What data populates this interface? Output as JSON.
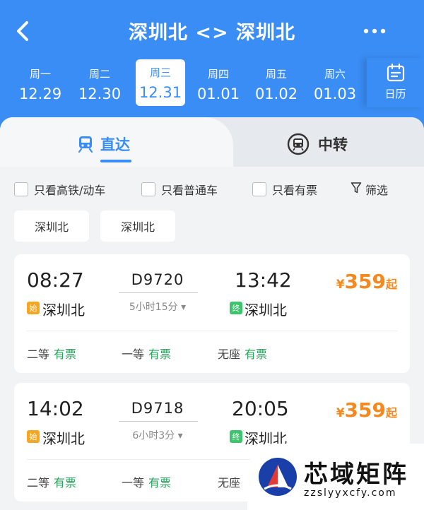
{
  "header": {
    "title": "深圳北 <> 深圳北",
    "dates": [
      {
        "weekday": "周一",
        "date": "12.29"
      },
      {
        "weekday": "周二",
        "date": "12.30"
      },
      {
        "weekday": "周三",
        "date": "12.31"
      },
      {
        "weekday": "周四",
        "date": "01.01"
      },
      {
        "weekday": "周五",
        "date": "01.02"
      },
      {
        "weekday": "周六",
        "date": "01.03"
      }
    ],
    "selected_date_index": 2,
    "calendar_label": "日历"
  },
  "tabs": {
    "direct": "直达",
    "transfer": "中转"
  },
  "filters": {
    "high_speed": "只看高铁/动车",
    "regular": "只看普通车",
    "available": "只看有票",
    "filter": "筛选"
  },
  "stations": [
    "深圳北",
    "深圳北"
  ],
  "trains": [
    {
      "depart_time": "08:27",
      "train_no": "D9720",
      "duration": "5小时15分",
      "arrive_time": "13:42",
      "from_badge": "始",
      "from": "深圳北",
      "to_badge": "终",
      "to": "深圳北",
      "price_symbol": "¥",
      "price": "359",
      "price_suffix": "起",
      "seats": [
        {
          "class": "二等",
          "status": "有票"
        },
        {
          "class": "一等",
          "status": "有票"
        },
        {
          "class": "无座",
          "status": "有票"
        }
      ]
    },
    {
      "depart_time": "14:02",
      "train_no": "D9718",
      "duration": "6小时3分",
      "arrive_time": "20:05",
      "from_badge": "始",
      "from": "深圳北",
      "to_badge": "终",
      "to": "深圳北",
      "price_symbol": "¥",
      "price": "359",
      "price_suffix": "起",
      "seats": [
        {
          "class": "二等",
          "status": "有票"
        },
        {
          "class": "一等",
          "status": "有票"
        },
        {
          "class": "无座",
          "status": ""
        }
      ]
    }
  ],
  "watermark": {
    "brand": "芯域矩阵",
    "site": "zzslyyxcfy.com"
  },
  "colors": {
    "primary": "#3a8df5",
    "price": "#f5891f",
    "available": "#27a55a",
    "start_badge": "#f5a623",
    "end_badge": "#3ec46d"
  }
}
